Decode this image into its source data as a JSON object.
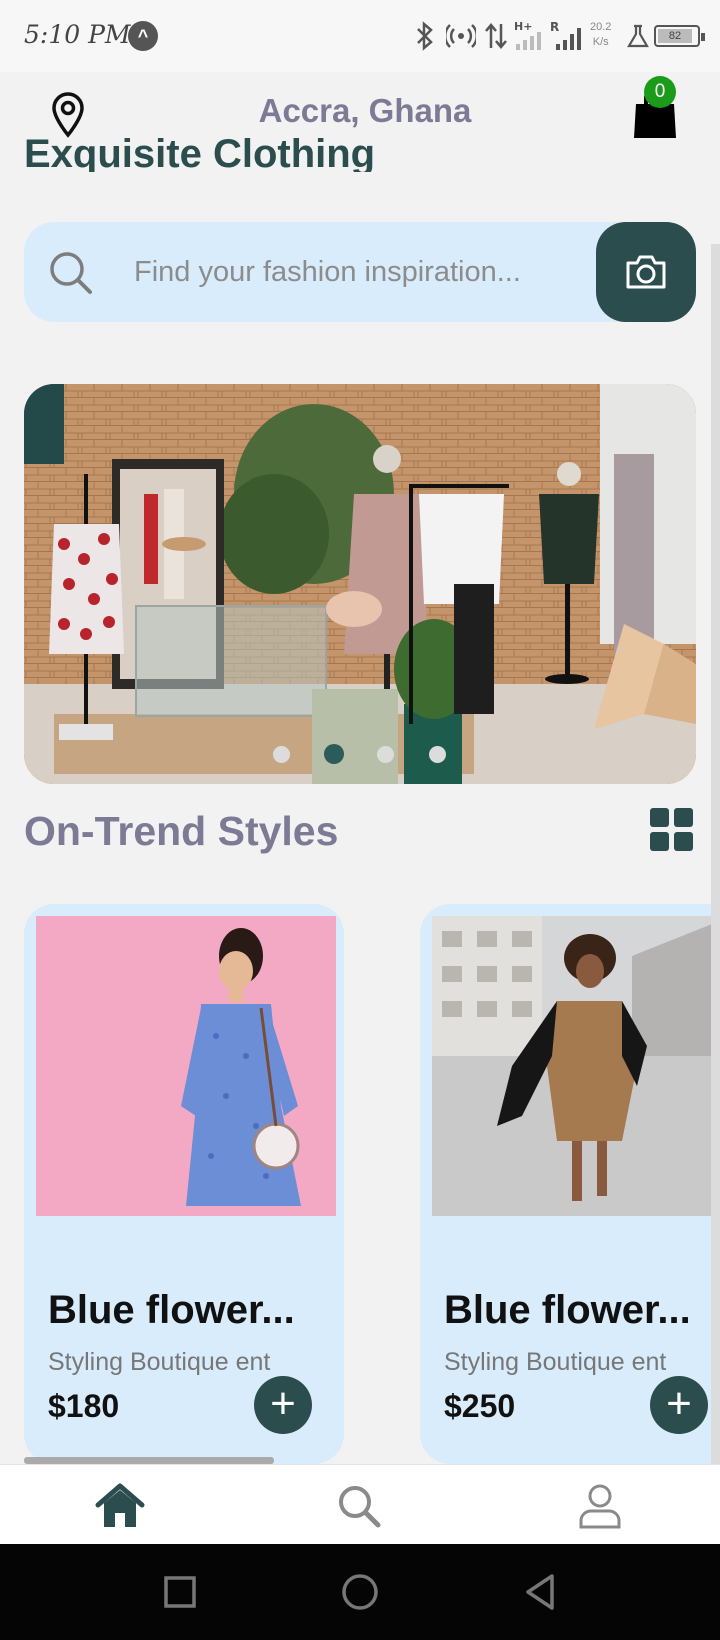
{
  "status_bar": {
    "time": "5:10 PM",
    "network_speed_value": "20.2",
    "network_speed_unit": "K/s",
    "battery": "82"
  },
  "header": {
    "location": "Accra, Ghana",
    "cart_count": "0",
    "page_heading": "Exquisite Clothing"
  },
  "search": {
    "placeholder": "Find your fashion inspiration..."
  },
  "banner": {
    "dot_count": 4,
    "active_dot": 1
  },
  "section": {
    "title": "On-Trend Styles"
  },
  "products": [
    {
      "name": "Blue flower...",
      "shop": "Styling Boutique ent",
      "price": "$180",
      "add_label": "+"
    },
    {
      "name": "Blue flower...",
      "shop": "Styling Boutique ent",
      "price": "$250",
      "add_label": "+"
    }
  ],
  "bottom_nav": {
    "items": [
      "home-icon",
      "search-icon",
      "profile-icon"
    ],
    "active": "home-icon"
  },
  "colors": {
    "accent": "#2b4d4d",
    "card_bg": "#d9ecfb",
    "muted_title": "#7c7a95",
    "badge": "#1a9b1a"
  }
}
